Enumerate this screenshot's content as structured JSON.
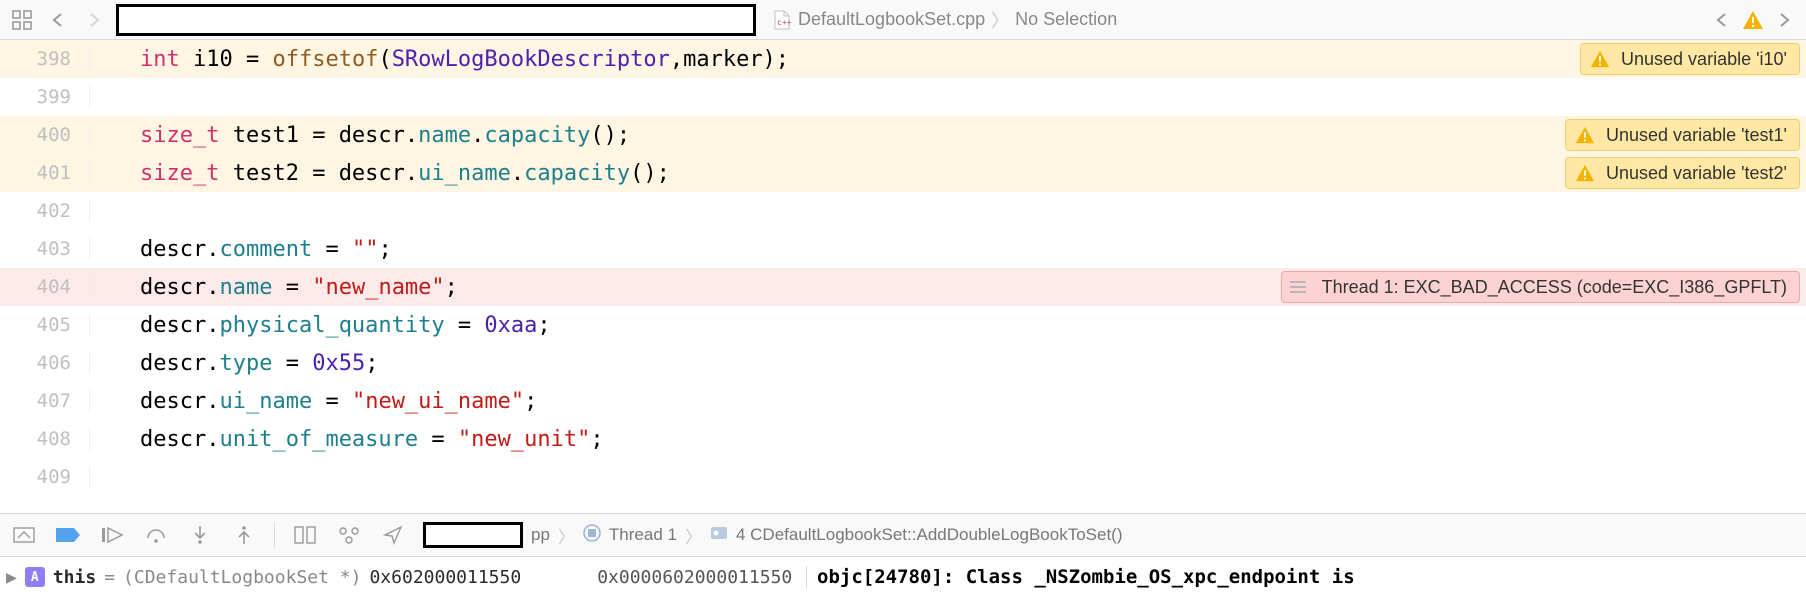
{
  "jumpbar": {
    "filename": "DefaultLogbookSet.cpp",
    "selection": "No Selection"
  },
  "code": {
    "lines": [
      {
        "n": 398,
        "style": "warn",
        "tokens": [
          [
            "k",
            "int"
          ],
          [
            "v",
            " i10 = "
          ],
          [
            "fn",
            "offsetof"
          ],
          [
            "v",
            "("
          ],
          [
            "t",
            "SRowLogBookDescriptor"
          ],
          [
            "v",
            ",marker);"
          ]
        ]
      },
      {
        "n": 399,
        "style": "",
        "tokens": []
      },
      {
        "n": 400,
        "style": "warn",
        "tokens": [
          [
            "k",
            "size_t"
          ],
          [
            "v",
            " test1 = descr."
          ],
          [
            "m",
            "name"
          ],
          [
            "v",
            "."
          ],
          [
            "m",
            "capacity"
          ],
          [
            "v",
            "();"
          ]
        ]
      },
      {
        "n": 401,
        "style": "warn",
        "tokens": [
          [
            "k",
            "size_t"
          ],
          [
            "v",
            " test2 = descr."
          ],
          [
            "m",
            "ui_name"
          ],
          [
            "v",
            "."
          ],
          [
            "m",
            "capacity"
          ],
          [
            "v",
            "();"
          ]
        ]
      },
      {
        "n": 402,
        "style": "",
        "tokens": []
      },
      {
        "n": 403,
        "style": "",
        "tokens": [
          [
            "v",
            "descr."
          ],
          [
            "m",
            "comment"
          ],
          [
            "v",
            " = "
          ],
          [
            "s",
            "\"\""
          ],
          [
            "v",
            ";"
          ]
        ]
      },
      {
        "n": 404,
        "style": "error",
        "tokens": [
          [
            "v",
            "descr."
          ],
          [
            "m",
            "name"
          ],
          [
            "v",
            " = "
          ],
          [
            "s",
            "\"new_name\""
          ],
          [
            "v",
            ";"
          ]
        ]
      },
      {
        "n": 405,
        "style": "",
        "tokens": [
          [
            "v",
            "descr."
          ],
          [
            "m",
            "physical_quantity"
          ],
          [
            "v",
            " = "
          ],
          [
            "n",
            "0xaa"
          ],
          [
            "v",
            ";"
          ]
        ]
      },
      {
        "n": 406,
        "style": "",
        "tokens": [
          [
            "v",
            "descr."
          ],
          [
            "m",
            "type"
          ],
          [
            "v",
            " = "
          ],
          [
            "n",
            "0x55"
          ],
          [
            "v",
            ";"
          ]
        ]
      },
      {
        "n": 407,
        "style": "",
        "tokens": [
          [
            "v",
            "descr."
          ],
          [
            "m",
            "ui_name"
          ],
          [
            "v",
            " = "
          ],
          [
            "s",
            "\"new_ui_name\""
          ],
          [
            "v",
            ";"
          ]
        ]
      },
      {
        "n": 408,
        "style": "",
        "tokens": [
          [
            "v",
            "descr."
          ],
          [
            "m",
            "unit_of_measure"
          ],
          [
            "v",
            " = "
          ],
          [
            "s",
            "\"new_unit\""
          ],
          [
            "v",
            ";"
          ]
        ]
      },
      {
        "n": 409,
        "style": "",
        "tokens": []
      }
    ]
  },
  "issues": {
    "398": {
      "kind": "warn",
      "text": "Unused variable 'i10'"
    },
    "400": {
      "kind": "warn",
      "text": "Unused variable 'test1'"
    },
    "401": {
      "kind": "warn",
      "text": "Unused variable 'test2'"
    },
    "404": {
      "kind": "error",
      "text": "Thread 1: EXC_BAD_ACCESS (code=EXC_I386_GPFLT)"
    }
  },
  "debug": {
    "file_suffix": "pp",
    "thread": "Thread 1",
    "frame": "4 CDefaultLogbookSet::AddDoubleLogBookToSet()"
  },
  "locals": {
    "this_label": "this",
    "this_type": "(CDefaultLogbookSet *)",
    "this_value": "0x602000011550",
    "raw_value": "0x0000602000011550"
  },
  "console": {
    "line": "objc[24780]: Class _NSZombie_OS_xpc_endpoint is"
  }
}
